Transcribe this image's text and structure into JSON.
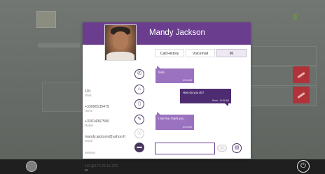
{
  "contact": {
    "name": "Mandy Jackson"
  },
  "details": [
    {
      "value": "101",
      "type": "Work"
    },
    {
      "value": "+33090135479",
      "type": "Home"
    },
    {
      "value": "+33014367590",
      "type": "Mobile"
    },
    {
      "value": "mandy.jackson@yahoo.fr",
      "type": "Email"
    },
    {
      "value": "",
      "type": "Website"
    },
    {
      "value": "101@172.25.16.226",
      "type": "IM"
    }
  ],
  "actions": {
    "call_icon": "phone-icon",
    "home_icon": "home-icon",
    "mobile_icon": "mobile-icon",
    "email_icon": "tag-icon",
    "website_icon": "globe-icon",
    "im_icon": "chat-icon"
  },
  "tabs": [
    {
      "label": "Call History",
      "active": false
    },
    {
      "label": "Voicemail",
      "active": false
    },
    {
      "label": "IM",
      "active": true
    }
  ],
  "messages": [
    {
      "direction": "in",
      "text": "hello",
      "time": "10:54 AM"
    },
    {
      "direction": "out",
      "text": "How do you do?",
      "time": "Read - 10:54 AM"
    },
    {
      "direction": "in",
      "text": "I am fine, thank you.",
      "time": "10:54 AM"
    }
  ],
  "compose": {
    "value": ""
  },
  "colors": {
    "header": "#6a3d8e",
    "incoming_bubble": "#9a72c0",
    "outgoing_bubble": "#4e2c72",
    "taskbar": "#1e1f1e"
  }
}
